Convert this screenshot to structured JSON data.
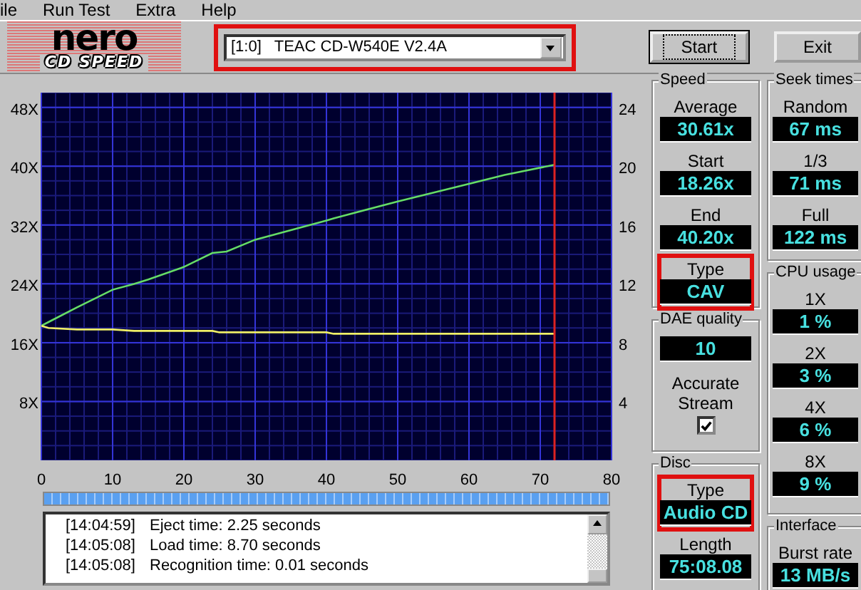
{
  "menu": [
    {
      "label": "ile"
    },
    {
      "label": "Run Test"
    },
    {
      "label": "Extra"
    },
    {
      "label": "Help"
    }
  ],
  "logo": {
    "line1": "nero",
    "line2": "CD SPEED"
  },
  "drive_select": {
    "value": "[1:0]   TEAC CD-W540E V2.4A",
    "highlighted": true
  },
  "buttons": [
    {
      "label": "Start",
      "default": true
    },
    {
      "label": "Exit",
      "default": false
    }
  ],
  "chart": {
    "chart_data": {
      "type": "line",
      "x": [
        0,
        1,
        5,
        10,
        13,
        15,
        20,
        24,
        25,
        26,
        30,
        40,
        41,
        50,
        60,
        65,
        72
      ],
      "series": [
        {
          "color": "#66dd66",
          "values": [
            18.3,
            18.8,
            20.8,
            23.2,
            24.0,
            24.6,
            26.3,
            28.2,
            28.3,
            28.4,
            30.0,
            32.6,
            32.9,
            35.2,
            37.6,
            38.8,
            40.2
          ]
        },
        {
          "color": "#eeee66",
          "values": [
            18.3,
            18.0,
            17.8,
            17.8,
            17.6,
            17.6,
            17.6,
            17.6,
            17.4,
            17.4,
            17.4,
            17.4,
            17.2,
            17.2,
            17.2,
            17.2,
            17.2
          ]
        }
      ],
      "xlim": [
        0,
        80
      ],
      "ylim": [
        0,
        50
      ],
      "xticks": [
        0,
        10,
        20,
        30,
        40,
        50,
        60,
        70,
        80
      ],
      "yticks": [
        {
          "value": 8,
          "label": "8X"
        },
        {
          "value": 16,
          "label": "16X"
        },
        {
          "value": 24,
          "label": "24X"
        },
        {
          "value": 32,
          "label": "32X"
        },
        {
          "value": 40,
          "label": "40X"
        },
        {
          "value": 48,
          "label": "48X"
        }
      ],
      "y2lim": [
        0,
        25
      ],
      "y2ticks": [
        4,
        8,
        12,
        16,
        20,
        24
      ],
      "grid": true,
      "ref_lines": [
        {
          "axis": "x",
          "value": 72,
          "color": "#dd2222"
        }
      ]
    }
  },
  "progress": {
    "level": 1
  },
  "log": [
    {
      "time": "[14:04:59]",
      "message": "Eject time: 2.25 seconds"
    },
    {
      "time": "[14:05:08]",
      "message": "Load time: 8.70 seconds"
    },
    {
      "time": "[14:05:08]",
      "message": "Recognition time: 0.01 seconds"
    }
  ],
  "panel_columns": [
    [
      {
        "title": "Speed",
        "fields": [
          {
            "kind": "readout",
            "label": "Average",
            "value": "30.61x",
            "highlighted": false
          },
          {
            "kind": "readout",
            "label": "Start",
            "value": "18.26x",
            "highlighted": false
          },
          {
            "kind": "readout",
            "label": "End",
            "value": "40.20x",
            "highlighted": false
          },
          {
            "kind": "readout",
            "label": "Type",
            "value": "CAV",
            "highlighted": true
          }
        ]
      },
      {
        "title": "DAE quality",
        "fields": [
          {
            "kind": "readout",
            "value": "10",
            "highlighted": false
          },
          {
            "kind": "checkbox",
            "label": "Accurate Stream",
            "checked": true
          }
        ]
      },
      {
        "title": "Disc",
        "fields": [
          {
            "kind": "readout",
            "label": "Type",
            "value": "Audio CD",
            "highlighted": true
          },
          {
            "kind": "readout",
            "label": "Length",
            "value": "75:08.08",
            "highlighted": false
          }
        ]
      }
    ],
    [
      {
        "title": "Seek times",
        "fields": [
          {
            "kind": "readout",
            "label": "Random",
            "value": "67 ms",
            "highlighted": false
          },
          {
            "kind": "readout",
            "label": "1/3",
            "value": "71 ms",
            "highlighted": false
          },
          {
            "kind": "readout",
            "label": "Full",
            "value": "122 ms",
            "highlighted": false
          }
        ]
      },
      {
        "title": "CPU usage",
        "fields": [
          {
            "kind": "readout",
            "label": "1X",
            "value": "1 %",
            "highlighted": false
          },
          {
            "kind": "readout",
            "label": "2X",
            "value": "3 %",
            "highlighted": false
          },
          {
            "kind": "readout",
            "label": "4X",
            "value": "6 %",
            "highlighted": false
          },
          {
            "kind": "readout",
            "label": "8X",
            "value": "9 %",
            "highlighted": false
          }
        ]
      },
      {
        "title": "Interface",
        "fields": [
          {
            "kind": "readout",
            "label": "Burst rate",
            "value": "13 MB/s",
            "highlighted": false
          }
        ]
      }
    ]
  ]
}
